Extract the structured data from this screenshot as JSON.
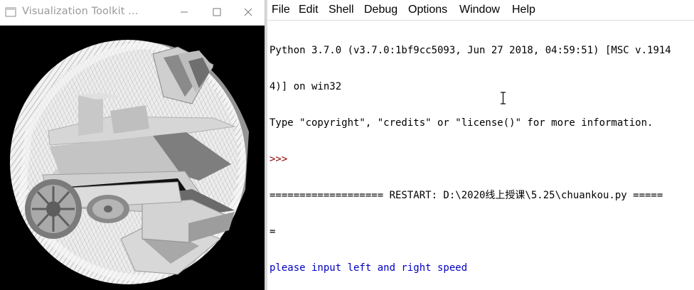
{
  "vtk_window": {
    "title": "Visualization Toolkit ...",
    "buttons": {
      "minimize": "minimize-icon",
      "maximize": "maximize-icon",
      "close": "close-icon"
    }
  },
  "shell": {
    "menu": [
      "File",
      "Edit",
      "Shell",
      "Debug",
      "Options",
      "Window",
      "Help"
    ],
    "lines": [
      "Python 3.7.0 (v3.7.0:1bf9cc5093, Jun 27 2018, 04:59:51) [MSC v.1914",
      "4)] on win32",
      "Type \"copyright\", \"credits\" or \"license()\" for more information.",
      ">>> ",
      "=================== RESTART: D:\\2020线上授课\\5.25\\chuankou.py =====",
      "=",
      "please input left and right speed"
    ]
  },
  "colors": {
    "prompt": "#8b0000",
    "output_blue": "#0000c0",
    "vtk_background": "#000000"
  }
}
